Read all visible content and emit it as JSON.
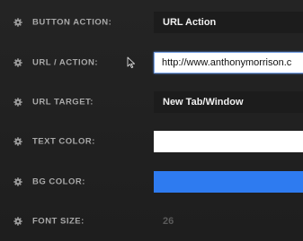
{
  "rows": [
    {
      "label": "BUTTON ACTION:",
      "value": "URL Action"
    },
    {
      "label": "URL / ACTION:",
      "value": "http://www.anthonymorrison.c"
    },
    {
      "label": "URL TARGET:",
      "value": "New Tab/Window"
    },
    {
      "label": "TEXT COLOR:",
      "value": ""
    },
    {
      "label": "BG COLOR:",
      "value": ""
    },
    {
      "label": "FONT SIZE:",
      "value": "26"
    }
  ],
  "colors": {
    "text_color": "#ffffff",
    "bg_color": "#2e7bf0",
    "label_color": "#a9a9a9"
  },
  "icons": {
    "row_icon": "gear-icon",
    "cursor": "mouse-pointer-icon"
  }
}
